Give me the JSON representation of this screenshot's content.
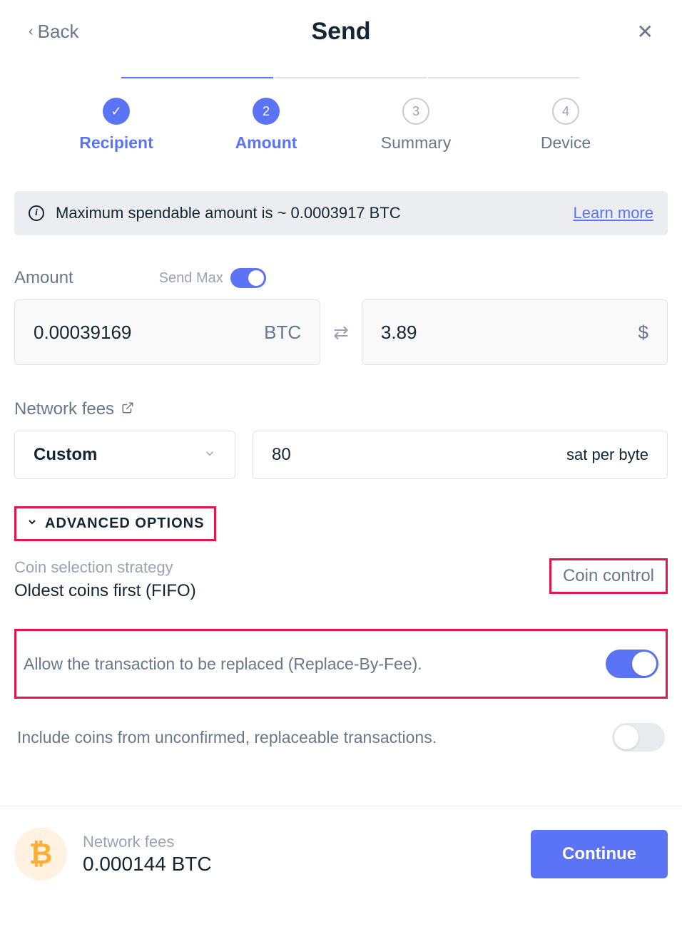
{
  "header": {
    "back_label": "Back",
    "title": "Send"
  },
  "stepper": {
    "steps": [
      {
        "label": "Recipient",
        "state": "done"
      },
      {
        "label": "Amount",
        "num": "2",
        "state": "active"
      },
      {
        "label": "Summary",
        "num": "3",
        "state": "pending"
      },
      {
        "label": "Device",
        "num": "4",
        "state": "pending"
      }
    ]
  },
  "info_banner": {
    "text": "Maximum spendable amount is ~ 0.0003917 BTC",
    "learn_more": "Learn more"
  },
  "amount": {
    "label": "Amount",
    "send_max_label": "Send Max",
    "crypto_value": "0.00039169",
    "crypto_unit": "BTC",
    "fiat_value": "3.89",
    "fiat_unit": "$"
  },
  "network_fees": {
    "label": "Network fees",
    "select_value": "Custom",
    "fee_value": "80",
    "fee_unit": "sat per byte"
  },
  "advanced": {
    "toggle_label": "ADVANCED OPTIONS",
    "coin_strategy_label": "Coin selection strategy",
    "coin_strategy_value": "Oldest coins first (FIFO)",
    "coin_control_btn": "Coin control",
    "rbf_label": "Allow the transaction to be replaced (Replace-By-Fee).",
    "unconfirmed_label": "Include coins from unconfirmed, replaceable transactions."
  },
  "footer": {
    "fee_label": "Network fees",
    "fee_value": "0.000144 BTC",
    "continue_label": "Continue",
    "btc_symbol": "₿"
  }
}
